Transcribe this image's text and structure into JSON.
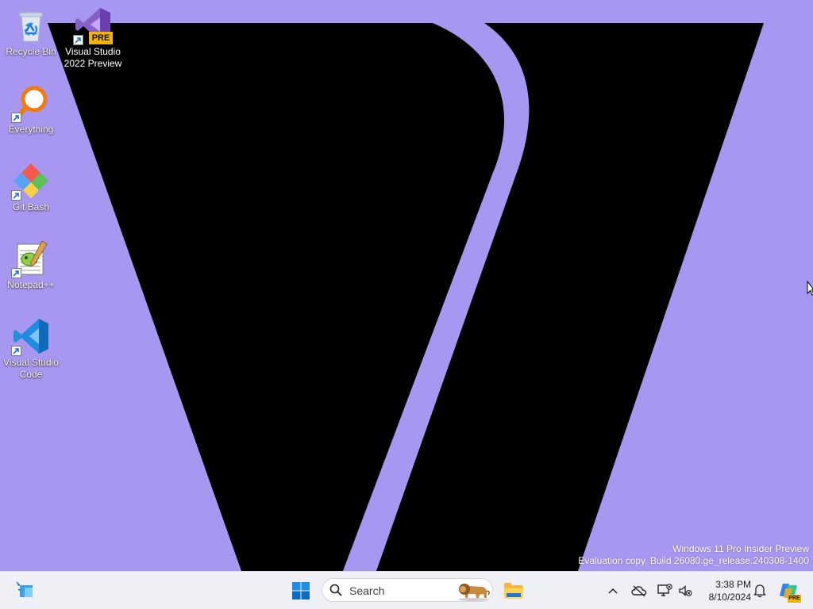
{
  "desktop": {
    "background_color": "#a797f1",
    "icons": [
      {
        "label": "Recycle Bin",
        "icon": "recycle-bin-icon"
      },
      {
        "label": "Visual Studio 2022 Preview",
        "icon": "visual-studio-preview-icon",
        "badge": "PRE"
      },
      {
        "label": "Everything",
        "icon": "everything-search-icon"
      },
      {
        "label": "Git Bash",
        "icon": "git-bash-icon"
      },
      {
        "label": "Notepad++",
        "icon": "notepad-plus-plus-icon"
      },
      {
        "label": "Visual Studio Code",
        "icon": "vscode-icon"
      }
    ],
    "watermark": {
      "line1": "Windows 11 Pro Insider Preview",
      "line2": "Evaluation copy. Build 26080.ge_release.240308-1400"
    }
  },
  "taskbar": {
    "search": {
      "placeholder": "Search"
    },
    "clock": {
      "time": "3:38 PM",
      "date": "8/10/2024"
    },
    "copilot_badge": "PRE",
    "accent": "#0078d4"
  }
}
